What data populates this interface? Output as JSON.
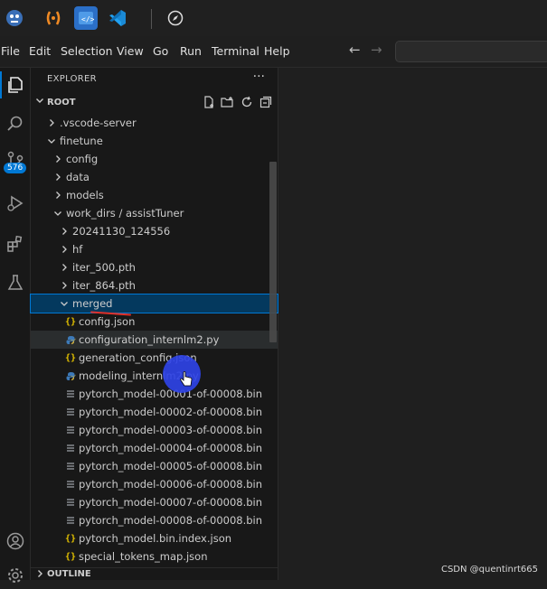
{
  "taskbar": {
    "icons": [
      "app-mascot-icon",
      "orange-brackets-app-icon",
      "code-window-icon",
      "vscode-icon",
      "compass-icon"
    ]
  },
  "menu": {
    "items": [
      "File",
      "Edit",
      "Selection",
      "View",
      "Go",
      "Run",
      "Terminal",
      "Help"
    ],
    "back_arrow": "←",
    "forward_arrow": "→"
  },
  "activity": {
    "source_control_badge": "576"
  },
  "explorer": {
    "title": "EXPLORER",
    "more": "···",
    "root_label": "ROOT",
    "outline_label": "OUTLINE",
    "tree": [
      {
        "label": ".vscode-server",
        "depth": 1,
        "type": "folder",
        "expanded": false
      },
      {
        "label": "finetune",
        "depth": 1,
        "type": "folder",
        "expanded": true
      },
      {
        "label": "config",
        "depth": 2,
        "type": "folder",
        "expanded": false
      },
      {
        "label": "data",
        "depth": 2,
        "type": "folder",
        "expanded": false
      },
      {
        "label": "models",
        "depth": 2,
        "type": "folder",
        "expanded": false
      },
      {
        "label": "work_dirs / assistTuner",
        "depth": 2,
        "type": "folder",
        "expanded": true
      },
      {
        "label": "20241130_124556",
        "depth": 3,
        "type": "folder",
        "expanded": false
      },
      {
        "label": "hf",
        "depth": 3,
        "type": "folder",
        "expanded": false
      },
      {
        "label": "iter_500.pth",
        "depth": 3,
        "type": "folder",
        "expanded": false
      },
      {
        "label": "iter_864.pth",
        "depth": 3,
        "type": "folder",
        "expanded": false
      },
      {
        "label": "merged",
        "depth": 3,
        "type": "folder",
        "expanded": true,
        "selected": true
      },
      {
        "label": "config.json",
        "depth": 4,
        "type": "json"
      },
      {
        "label": "configuration_internlm2.py",
        "depth": 4,
        "type": "py",
        "hover": true
      },
      {
        "label": "generation_config.json",
        "depth": 4,
        "type": "json"
      },
      {
        "label": "modeling_internlm2.py",
        "depth": 4,
        "type": "py"
      },
      {
        "label": "pytorch_model-00001-of-00008.bin",
        "depth": 4,
        "type": "bin"
      },
      {
        "label": "pytorch_model-00002-of-00008.bin",
        "depth": 4,
        "type": "bin"
      },
      {
        "label": "pytorch_model-00003-of-00008.bin",
        "depth": 4,
        "type": "bin"
      },
      {
        "label": "pytorch_model-00004-of-00008.bin",
        "depth": 4,
        "type": "bin"
      },
      {
        "label": "pytorch_model-00005-of-00008.bin",
        "depth": 4,
        "type": "bin"
      },
      {
        "label": "pytorch_model-00006-of-00008.bin",
        "depth": 4,
        "type": "bin"
      },
      {
        "label": "pytorch_model-00007-of-00008.bin",
        "depth": 4,
        "type": "bin"
      },
      {
        "label": "pytorch_model-00008-of-00008.bin",
        "depth": 4,
        "type": "bin"
      },
      {
        "label": "pytorch_model.bin.index.json",
        "depth": 4,
        "type": "json"
      },
      {
        "label": "special_tokens_map.json",
        "depth": 4,
        "type": "json"
      }
    ]
  },
  "watermark": "CSDN @quentinrt665",
  "colors": {
    "accent": "#0078d4",
    "selection": "#04395e",
    "json_icon": "#e2c000",
    "py_icon": "#4b8bbe",
    "cursor_highlight": "#2f43e6",
    "annotation_underline": "#e0302a"
  }
}
